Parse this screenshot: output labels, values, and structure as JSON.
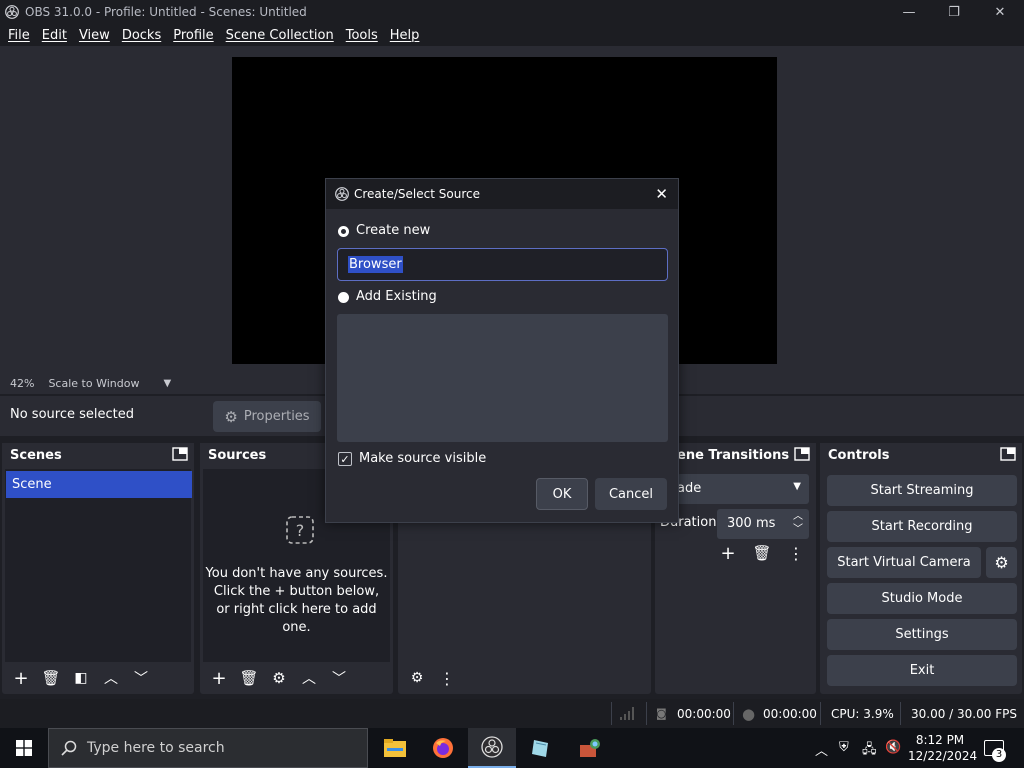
{
  "window": {
    "title": "OBS 31.0.0 - Profile: Untitled - Scenes: Untitled",
    "minimize": "—",
    "maximize": "❐",
    "close": "✕"
  },
  "menu": [
    "File",
    "Edit",
    "View",
    "Docks",
    "Profile",
    "Scene Collection",
    "Tools",
    "Help"
  ],
  "preview": {
    "zoom": "42%",
    "scale_mode": "Scale to Window"
  },
  "source_bar": {
    "no_source": "No source selected",
    "properties": "Properties"
  },
  "scenes": {
    "title": "Scenes",
    "items": [
      "Scene"
    ]
  },
  "sources": {
    "title": "Sources",
    "empty_line1": "You don't have any sources.",
    "empty_line2": "Click the + button below,",
    "empty_line3": "or right click here to add one."
  },
  "transitions": {
    "title": "Scene Transitions",
    "visible_title": "ene Transitions",
    "type": "ade",
    "duration_label": "Duration",
    "duration_value": "300 ms"
  },
  "controls": {
    "title": "Controls",
    "buttons": [
      "Start Streaming",
      "Start Recording",
      "Start Virtual Camera",
      "Studio Mode",
      "Settings",
      "Exit"
    ]
  },
  "status": {
    "stream_time": "00:00:00",
    "record_time": "00:00:00",
    "cpu": "CPU: 3.9%",
    "fps": "30.00 / 30.00 FPS"
  },
  "dialog": {
    "title": "Create/Select Source",
    "create_new": "Create new",
    "name_value": "Browser",
    "add_existing": "Add Existing",
    "make_visible": "Make source visible",
    "make_visible_checked": true,
    "ok": "OK",
    "cancel": "Cancel"
  },
  "taskbar": {
    "search_placeholder": "Type here to search",
    "time": "8:12 PM",
    "date": "12/22/2024",
    "notifications": "3"
  },
  "colors": {
    "accent": "#2f50c7",
    "panel": "#2a2b33",
    "button": "#3c404b"
  }
}
